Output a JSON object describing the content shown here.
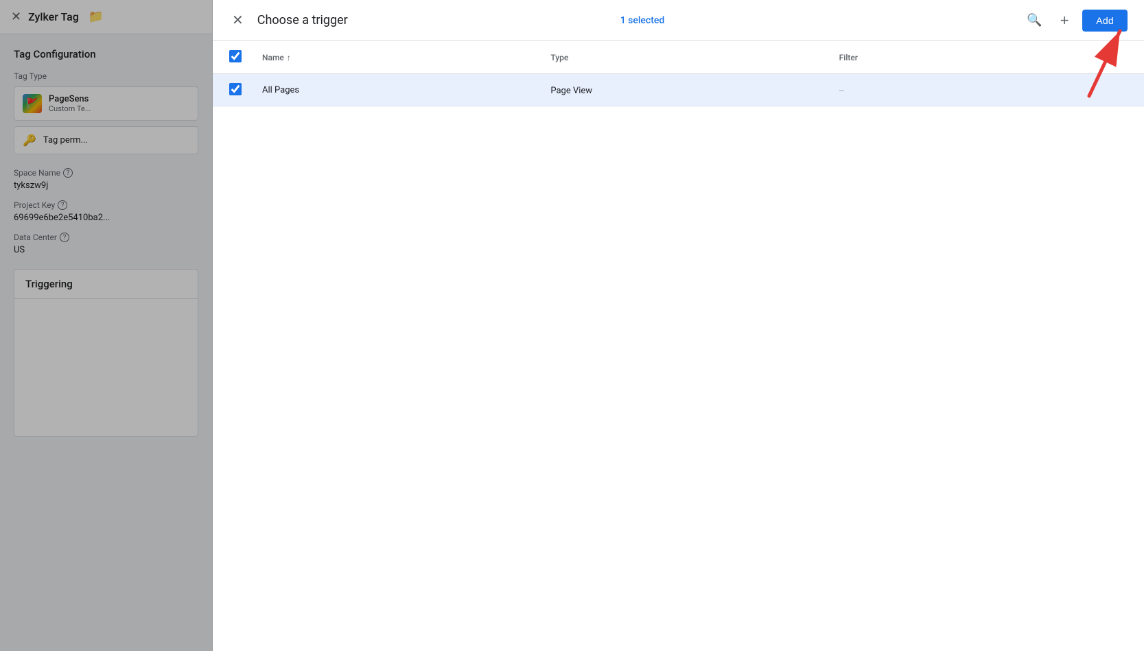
{
  "app": {
    "title": "Zylker Tag",
    "close_label": "×",
    "folder_icon": "📁"
  },
  "background": {
    "tag_config_title": "Tag Configuration",
    "tag_type_label": "Tag Type",
    "pagesens_name": "PageSens",
    "pagesens_subtitle": "Custom Te...",
    "tag_perm_label": "Tag perm...",
    "space_name_label": "Space Name",
    "space_name_help": "?",
    "space_name_value": "tykszw9j",
    "project_key_label": "Project Key",
    "project_key_help": "?",
    "project_key_value": "69699e6be2e5410ba2...",
    "data_center_label": "Data Center",
    "data_center_help": "?",
    "data_center_value": "US",
    "triggering_title": "Triggering"
  },
  "modal": {
    "title": "Choose a trigger",
    "selected_text": "1 selected",
    "close_label": "×",
    "search_icon": "🔍",
    "add_icon": "+",
    "add_label": "Add",
    "table": {
      "col_name": "Name",
      "col_sort_icon": "↑",
      "col_type": "Type",
      "col_filter": "Filter",
      "rows": [
        {
          "name": "All Pages",
          "type": "Page View",
          "filter": "--",
          "checked": true
        }
      ]
    }
  }
}
